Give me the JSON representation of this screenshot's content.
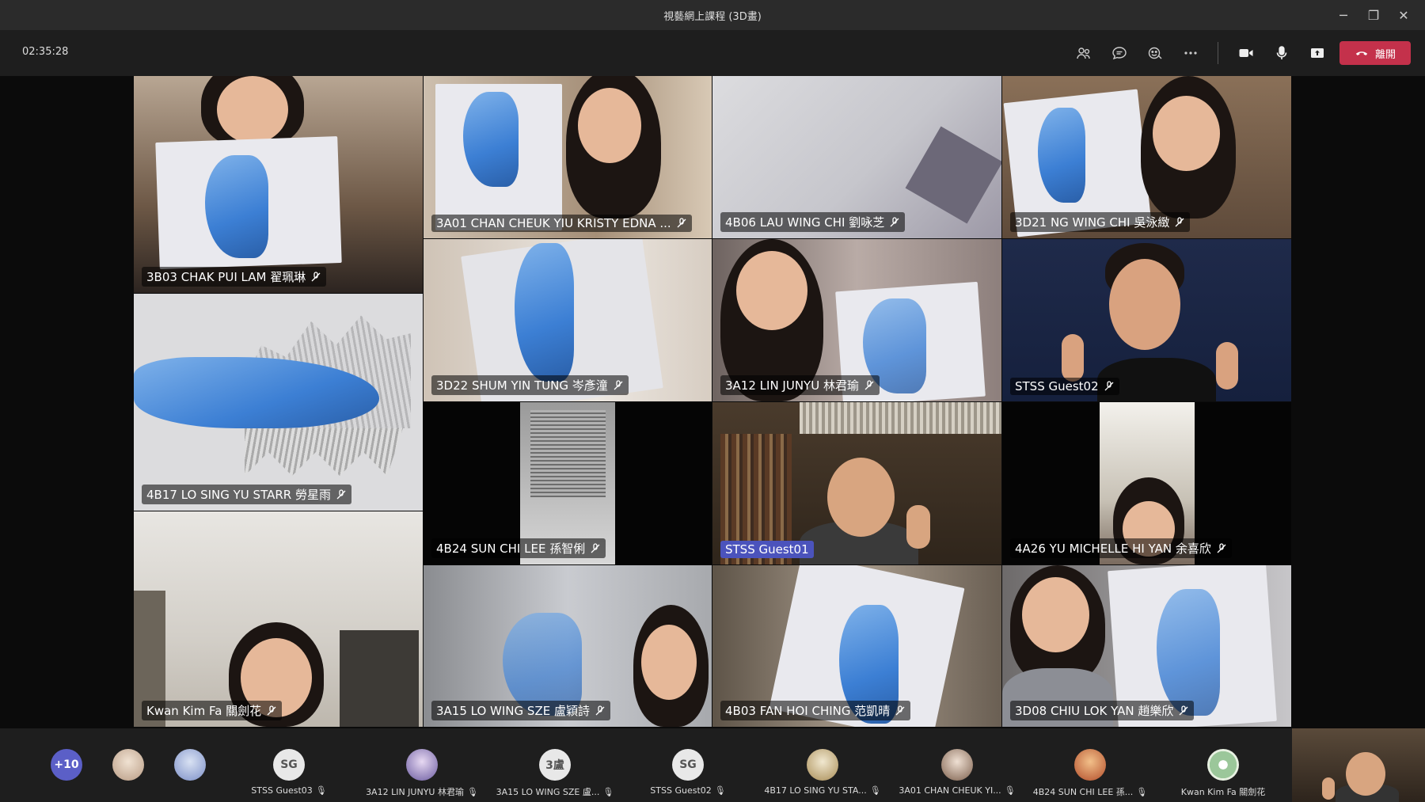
{
  "window": {
    "title": "視藝網上課程 (3D畫)",
    "minimize": "─",
    "restore": "❐",
    "close": "✕"
  },
  "toolbar": {
    "timer": "02:35:28",
    "leave_label": "離開"
  },
  "tiles": [
    {
      "name": "3B03 CHAK PUI LAM 翟珮琳"
    },
    {
      "name": "3A01 CHAN CHEUK YIU KRISTY EDNA ..."
    },
    {
      "name": "4B06 LAU WING CHI 劉咏芝"
    },
    {
      "name": "3D21 NG WING CHI 吳泳緻"
    },
    {
      "name": "4B17 LO SING YU STARR 勞星雨"
    },
    {
      "name": "3D22 SHUM YIN TUNG 岑彥潼"
    },
    {
      "name": "3A12 LIN JUNYU 林君瑜"
    },
    {
      "name": "STSS Guest02"
    },
    {
      "name": "4B24 SUN CHI LEE 孫智俐"
    },
    {
      "name": "STSS Guest01"
    },
    {
      "name": "4A26 YU MICHELLE HI YAN 余喜欣"
    },
    {
      "name": "Kwan Kim Fa 關劍花"
    },
    {
      "name": "3A15 LO WING SZE 盧穎詩"
    },
    {
      "name": "4B03 FAN HOI CHING 范凱晴"
    },
    {
      "name": "3D08 CHIU LOK YAN 趙樂欣"
    }
  ],
  "participants_bar": {
    "more_count": "+10",
    "slots": [
      {
        "initials": "SG",
        "name": "STSS Guest03"
      },
      {
        "initials": "",
        "name": "3A12 LIN JUNYU 林君瑜"
      },
      {
        "initials": "3盧",
        "name": "3A15 LO WING SZE 盧..."
      },
      {
        "initials": "SG",
        "name": "STSS Guest02"
      },
      {
        "initials": "",
        "name": "4B17 LO SING YU STA..."
      },
      {
        "initials": "",
        "name": "3A01 CHAN CHEUK YI..."
      },
      {
        "initials": "",
        "name": "4B24 SUN CHI LEE 孫..."
      },
      {
        "initials": "",
        "name": "Kwan Kim Fa 關劍花"
      }
    ]
  },
  "colors": {
    "accent": "#5b5fc7",
    "leave": "#c4314b",
    "highlight_tag": "#4b53bc"
  }
}
